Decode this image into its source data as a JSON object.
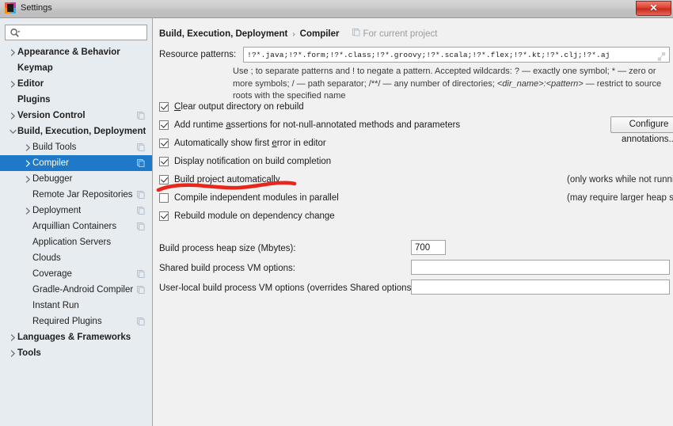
{
  "window": {
    "title": "Settings",
    "logo_icon": "intellij-idea-logo-icon",
    "close_label": "✕"
  },
  "sidebar": {
    "search": {
      "placeholder": "",
      "value": "",
      "icon": "search-icon"
    },
    "items": [
      {
        "label": "Appearance & Behavior",
        "level": 0,
        "arrow": "right",
        "badge": false
      },
      {
        "label": "Keymap",
        "level": 0,
        "arrow": "none",
        "badge": false
      },
      {
        "label": "Editor",
        "level": 0,
        "arrow": "right",
        "badge": false
      },
      {
        "label": "Plugins",
        "level": 0,
        "arrow": "none",
        "badge": false
      },
      {
        "label": "Version Control",
        "level": 0,
        "arrow": "right",
        "badge": true
      },
      {
        "label": "Build, Execution, Deployment",
        "level": 0,
        "arrow": "down",
        "badge": false
      },
      {
        "label": "Build Tools",
        "level": 1,
        "arrow": "right",
        "badge": true
      },
      {
        "label": "Compiler",
        "level": 1,
        "arrow": "right",
        "badge": true,
        "selected": true
      },
      {
        "label": "Debugger",
        "level": 1,
        "arrow": "right",
        "badge": false
      },
      {
        "label": "Remote Jar Repositories",
        "level": 1,
        "arrow": "none",
        "badge": true
      },
      {
        "label": "Deployment",
        "level": 1,
        "arrow": "right",
        "badge": true
      },
      {
        "label": "Arquillian Containers",
        "level": 1,
        "arrow": "none",
        "badge": true
      },
      {
        "label": "Application Servers",
        "level": 1,
        "arrow": "none",
        "badge": false
      },
      {
        "label": "Clouds",
        "level": 1,
        "arrow": "none",
        "badge": false
      },
      {
        "label": "Coverage",
        "level": 1,
        "arrow": "none",
        "badge": true
      },
      {
        "label": "Gradle-Android Compiler",
        "level": 1,
        "arrow": "none",
        "badge": true
      },
      {
        "label": "Instant Run",
        "level": 1,
        "arrow": "none",
        "badge": false
      },
      {
        "label": "Required Plugins",
        "level": 1,
        "arrow": "none",
        "badge": true
      },
      {
        "label": "Languages & Frameworks",
        "level": 0,
        "arrow": "right",
        "badge": false
      },
      {
        "label": "Tools",
        "level": 0,
        "arrow": "right",
        "badge": false
      }
    ]
  },
  "main": {
    "breadcrumb": {
      "root": "Build, Execution, Deployment",
      "separator": "›",
      "leaf": "Compiler",
      "scope_note": "For current project",
      "scope_icon": "project-scope-icon"
    },
    "resource_patterns": {
      "label": "Resource patterns:",
      "value": "!?*.java;!?*.form;!?*.class;!?*.groovy;!?*.scala;!?*.flex;!?*.kt;!?*.clj;!?*.aj",
      "placeholder": "",
      "expand_icon": "expand-field-icon"
    },
    "help_text": {
      "line1_a": "Use ; to separate patterns and ! to negate a pattern. Accepted wildcards: ? — exactly one symbol; * — zero or more symbols;",
      "line2_a": "/ — path separator; /**/ — any number of directories; ",
      "line2_em": "<dir_name>:<pattern>",
      "line2_b": " — restrict to source roots with the specified",
      "line3": "name"
    },
    "checkboxes": [
      {
        "label": "Clear output directory on rebuild",
        "checked": true,
        "mnemonic": "C"
      },
      {
        "label": "Add runtime assertions for not-null-annotated methods and parameters",
        "checked": true,
        "mnemonic": "a"
      },
      {
        "label": "Automatically show first error in editor",
        "checked": true,
        "mnemonic": "e"
      },
      {
        "label": "Display notification on build completion",
        "checked": true,
        "mnemonic": ""
      },
      {
        "label": "Build project automatically",
        "checked": true,
        "mnemonic": "",
        "note": "(only works while not running / debugging)"
      },
      {
        "label": "Compile independent modules in parallel",
        "checked": false,
        "mnemonic": "",
        "note": "(may require larger heap size)"
      },
      {
        "label": "Rebuild module on dependency change",
        "checked": true,
        "mnemonic": ""
      }
    ],
    "configure_annotations_button": "Configure annotations...",
    "fields": [
      {
        "label": "Build process heap size (Mbytes):",
        "value": "700",
        "kind": "heap"
      },
      {
        "label": "Shared build process VM options:",
        "value": "",
        "kind": "shared"
      },
      {
        "label": "User-local build process VM options (overrides Shared options):",
        "value": "",
        "kind": "userlocal"
      }
    ]
  },
  "annotation": {
    "type": "hand-drawn-underline",
    "color": "#e8261c",
    "target": "Build project automatically"
  }
}
